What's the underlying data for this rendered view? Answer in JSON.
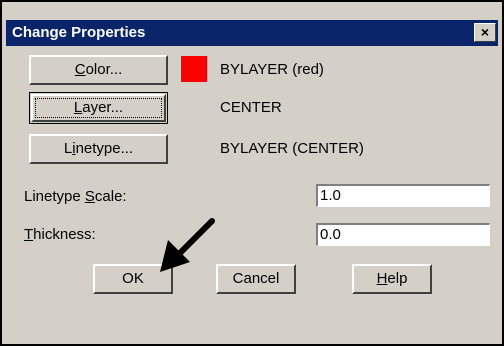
{
  "dialog": {
    "title": "Change Properties",
    "close_label": "×"
  },
  "properties": {
    "color": {
      "button_label": "Color...",
      "button_mnemonic": "C",
      "value": "BYLAYER (red)",
      "swatch_color": "#ff0000"
    },
    "layer": {
      "button_label": "Layer...",
      "button_mnemonic": "L",
      "value": "CENTER"
    },
    "linetype": {
      "button_label": "Linetype...",
      "button_mnemonic": "i",
      "value": "BYLAYER (CENTER)"
    }
  },
  "fields": {
    "linetype_scale": {
      "label": "Linetype Scale:",
      "mnemonic": "S",
      "value": "1.0"
    },
    "thickness": {
      "label": "Thickness:",
      "mnemonic": "T",
      "value": "0.0"
    }
  },
  "buttons": {
    "ok": "OK",
    "cancel": "Cancel",
    "help": "Help",
    "help_mnemonic": "H"
  },
  "colors": {
    "titlebar": "#0a246a",
    "dialog_bg": "#d4d0c8",
    "swatch": "#ff0000"
  },
  "annotation": {
    "arrow_icon": "pointer-arrow-icon"
  }
}
